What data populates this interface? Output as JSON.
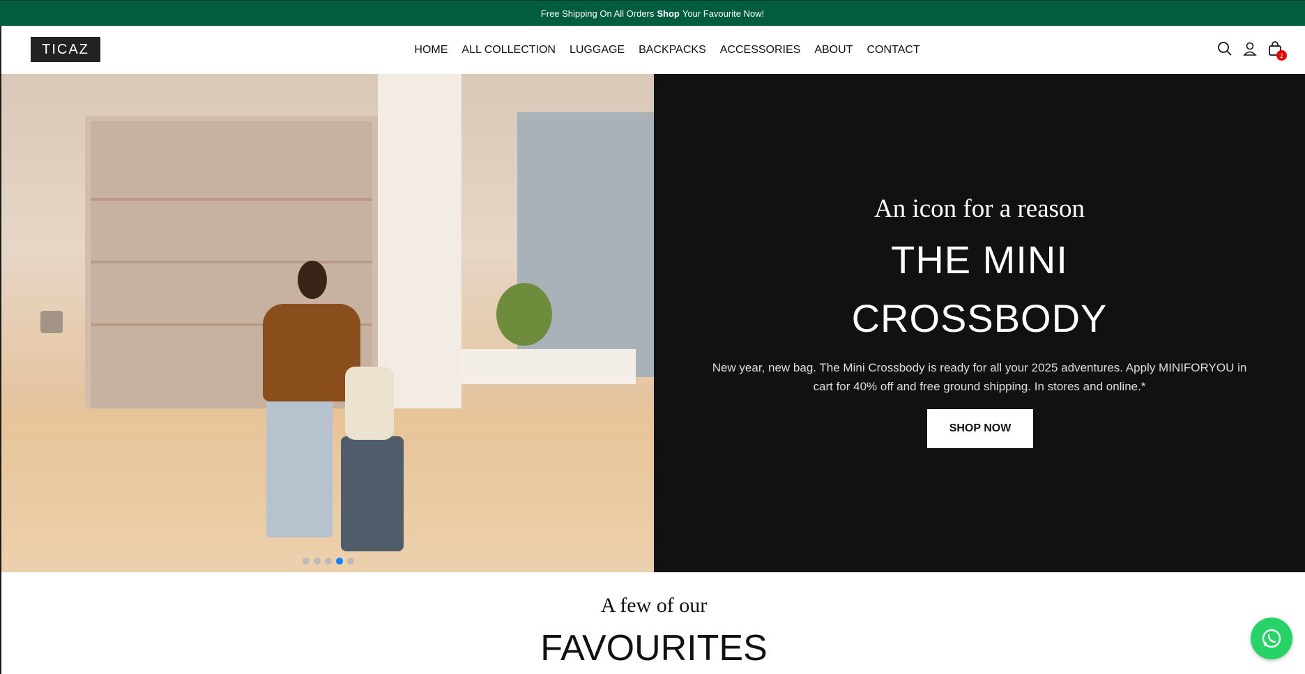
{
  "announcement": {
    "text_before": "Free Shipping On All Orders",
    "bold": "Shop",
    "text_after": "Your Favourite Now!"
  },
  "header": {
    "logo": "TICAZ",
    "nav": [
      "HOME",
      "ALL COLLECTION",
      "LUGGAGE",
      "BACKPACKS",
      "ACCESSORIES",
      "ABOUT",
      "CONTACT"
    ],
    "cart_count": "1",
    "icons": [
      "search-icon",
      "user-icon",
      "cart-icon"
    ]
  },
  "hero": {
    "tagline": "An icon for a reason",
    "headline_line1": "THE MINI",
    "headline_line2": "CROSSBODY",
    "description": "New year, new bag. The Mini Crossbody is ready for all your 2025 adventures. Apply MINIFORYOU in cart for 40% off and free ground shipping. In stores and online.*",
    "button": "SHOP NOW",
    "slide_count": 5,
    "active_slide": 4
  },
  "favourites": {
    "small": "A few of our",
    "big": "FAVOURITES"
  },
  "colors": {
    "announcement_bg": "#025c3f",
    "hero_bg": "#111111",
    "whatsapp": "#25d366"
  }
}
